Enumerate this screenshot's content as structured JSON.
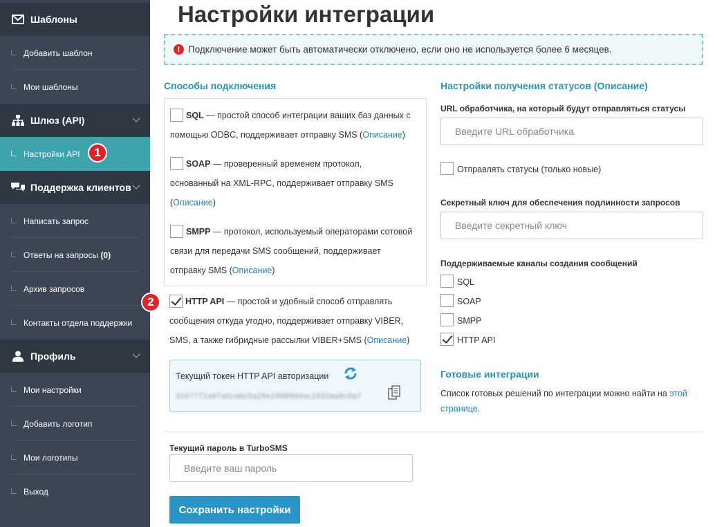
{
  "sidebar": {
    "sections": [
      {
        "title": "Шаблоны",
        "icon": "envelope-icon",
        "items": [
          "Добавить шаблон",
          "Мои шаблоны"
        ]
      },
      {
        "title": "Шлюз (API)",
        "icon": "sitemap-icon",
        "items": [
          "Настройки API"
        ]
      },
      {
        "title": "Поддержка клиентов",
        "icon": "chat-icon",
        "items": [
          "Написать запрос",
          "Ответы на запросы",
          "Архив запросов",
          "Контакты отдела поддержки"
        ]
      },
      {
        "title": "Профиль",
        "icon": "user-icon",
        "items": [
          "Мои настройки",
          "Добавить логотип",
          "Мои логотипы",
          "Выход"
        ]
      }
    ],
    "replies_count": "(0)",
    "active_item": "Настройки API",
    "badge1": "1",
    "badge2": "2"
  },
  "page": {
    "title": "Настройки интеграции",
    "notice": "Подключение может быть автоматически отключено, если оно не используется более 6 месяцев."
  },
  "methods": {
    "title": "Способы подключения",
    "sql": {
      "name": "SQL",
      "desc_line1": " — простой способ интеграции ваших баз данных с",
      "desc_line2": "помощью ODBC, поддерживает отправку SMS (",
      "link": "Описание",
      "close": ")"
    },
    "soap": {
      "name": "SOAP",
      "desc_line1": " — проверенный временем протокол,",
      "desc_line2": "основанный на XML-RPC, поддерживает отправку SMS",
      "desc_line3": "(",
      "link": "Описание",
      "close": ")"
    },
    "smpp": {
      "name": "SMPP",
      "desc_line1": " — протокол, используемый операторами сотовой",
      "desc_line2": "связи для передачи SMS сообщений, поддерживает",
      "desc_line3": "отправку SMS (",
      "link": "Описание",
      "close": ")"
    },
    "http": {
      "name": "HTTP API",
      "desc_line1": " — простой и удобный способ отправлять",
      "desc_line2": "сообщения откуда угодно, поддерживает отправку VIBER,",
      "desc_line3": "SMS, а также гибридные рассылки VIBER+SMS (",
      "link": "Описание",
      "close": ")",
      "checked": true
    }
  },
  "token": {
    "label": "Текущий токен HTTP API авторизации",
    "value": "3167771ab7a0cabc5a29e24989d4ac1632aa8c5a7"
  },
  "password": {
    "label": "Текущий пароль в TurboSMS",
    "placeholder": "Введите ваш пароль"
  },
  "save_button": "Сохранить настройки",
  "status": {
    "title": "Настройки получения статусов (",
    "title_link": "Описание",
    "title_close": ")",
    "url_label": "URL обработчика, на который будут отправляться статусы",
    "url_placeholder": "Введите URL обработчика",
    "send_new_label": "Отправлять статусы (только новые)",
    "secret_label": "Секретный ключ для обеспечения подлинности запросов",
    "secret_placeholder": "Введите секретный ключ",
    "channels_label": "Поддерживаемые каналы создания сообщений",
    "channels": [
      {
        "name": "SQL",
        "checked": false
      },
      {
        "name": "SOAP",
        "checked": false
      },
      {
        "name": "SMPP",
        "checked": false
      },
      {
        "name": "HTTP API",
        "checked": true
      }
    ]
  },
  "ready": {
    "title": "Готовые интеграции",
    "text": "Список готовых решений по интеграции можно найти на ",
    "link1": "этой",
    "link2": "странице",
    "end": "."
  }
}
